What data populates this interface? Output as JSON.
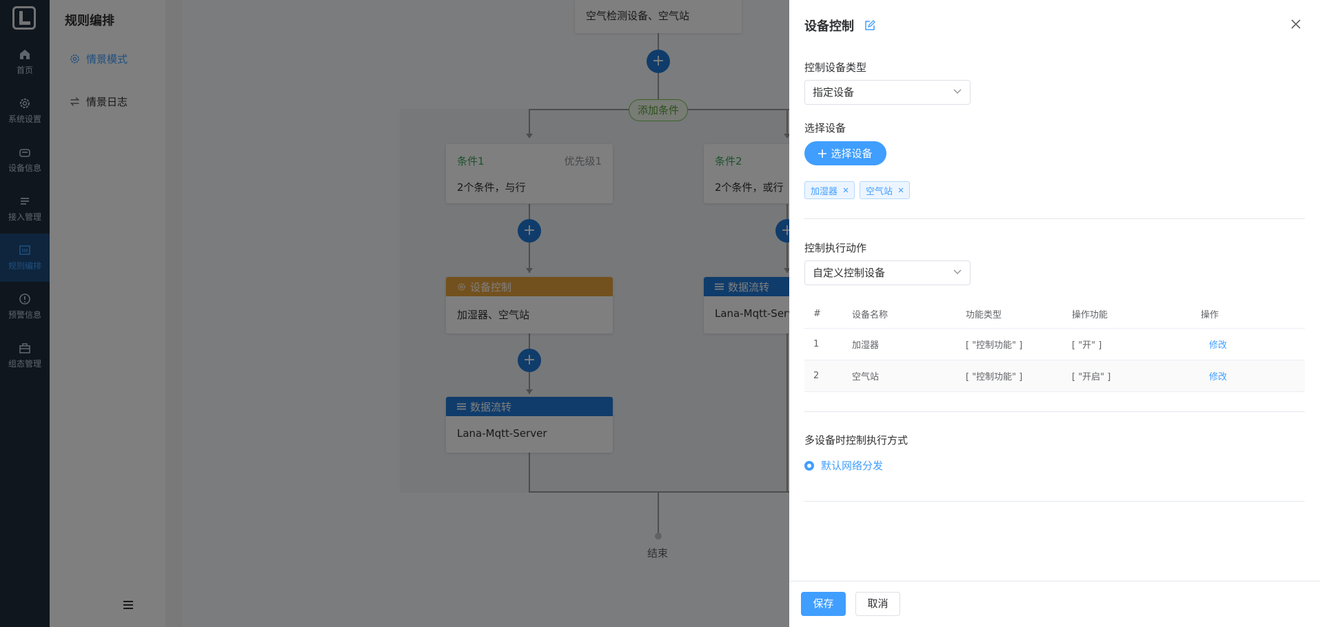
{
  "nav": {
    "items": [
      {
        "label": "首页",
        "icon": "home-icon"
      },
      {
        "label": "系统设置",
        "icon": "gear-icon"
      },
      {
        "label": "设备信息",
        "icon": "device-icon"
      },
      {
        "label": "接入管理",
        "icon": "list-icon"
      },
      {
        "label": "规则编排",
        "icon": "rule-icon"
      },
      {
        "label": "预警信息",
        "icon": "alert-icon"
      },
      {
        "label": "组态管理",
        "icon": "briefcase-icon"
      }
    ],
    "active_index": 4
  },
  "sub_sidebar": {
    "title": "规则编排",
    "items": [
      {
        "label": "情景模式",
        "icon": "gear-icon",
        "active": true
      },
      {
        "label": "情景日志",
        "icon": "swap-icon",
        "active": false
      }
    ]
  },
  "flow": {
    "top_node_text": "空气检测设备、空气站",
    "add_condition_label": "添加条件",
    "conditions": [
      {
        "title": "条件1",
        "priority": "优先级1",
        "desc": "2个条件，与行"
      },
      {
        "title": "条件2",
        "priority": "",
        "desc": "2个条件，或行"
      }
    ],
    "actions": [
      {
        "title": "设备控制",
        "body": "加湿器、空气站"
      },
      {
        "title": "数据流转",
        "body": "Lana-Mqtt-Server"
      },
      {
        "title": "数据流转",
        "body": "Lana-Mqtt-Serv"
      }
    ],
    "end_label": "结束"
  },
  "drawer": {
    "title": "设备控制",
    "device_type_label": "控制设备类型",
    "device_type_value": "指定设备",
    "select_device_label": "选择设备",
    "select_device_button": "选择设备",
    "selected_tags": [
      "加湿器",
      "空气站"
    ],
    "action_label": "控制执行动作",
    "action_value": "自定义控制设备",
    "table": {
      "headers": [
        "#",
        "设备名称",
        "功能类型",
        "操作功能",
        "操作"
      ],
      "rows": [
        [
          "1",
          "加湿器",
          "[ \"控制功能\" ]",
          "[ \"开\" ]",
          "修改"
        ],
        [
          "2",
          "空气站",
          "[ \"控制功能\" ]",
          "[ \"开启\" ]",
          "修改"
        ]
      ]
    },
    "multi_label": "多设备时控制执行方式",
    "multi_option": "默认网络分发",
    "save_label": "保存",
    "cancel_label": "取消"
  },
  "colors": {
    "primary": "#409eff",
    "nav_bg": "#1f2d3d",
    "condition_green": "#3aa55d",
    "action_orange": "#e6a23c",
    "flow_blue": "#1e78d6"
  }
}
